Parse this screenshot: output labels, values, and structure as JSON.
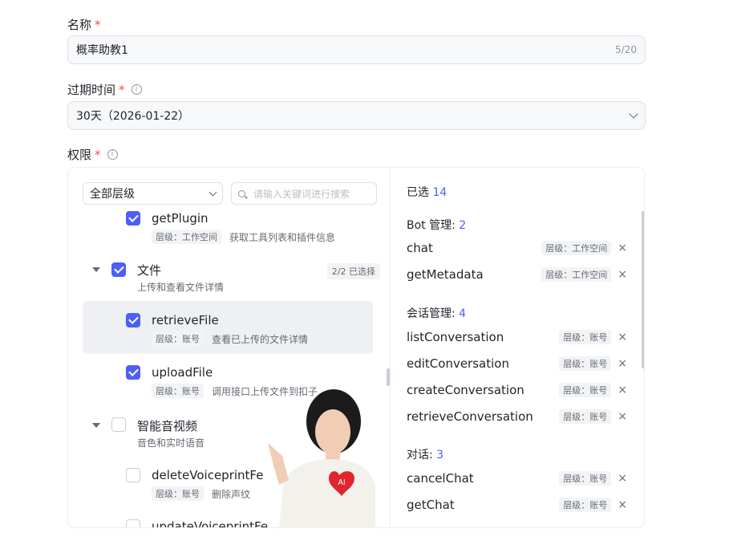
{
  "name_field": {
    "label": "名称",
    "required": "*",
    "value": "概率助教1",
    "counter": "5/20"
  },
  "expiry_field": {
    "label": "过期时间",
    "required": "*",
    "value": "30天（2026-01-22）"
  },
  "permission_field": {
    "label": "权限",
    "required": "*"
  },
  "left_panel": {
    "level_select": "全部层级",
    "search_placeholder": "请输入关键词进行搜索",
    "items": [
      {
        "name": "getPlugin",
        "level": "层级：工作空间",
        "desc": "获取工具列表和插件信息",
        "checked": true
      },
      {
        "group": "文件",
        "desc": "上传和查看文件详情",
        "badge": "2/2 已选择",
        "checked": true
      },
      {
        "name": "retrieveFile",
        "level": "层级：账号",
        "desc": "查看已上传的文件详情",
        "checked": true
      },
      {
        "name": "uploadFile",
        "level": "层级：账号",
        "desc": "调用接口上传文件到扣子",
        "checked": true
      },
      {
        "group": "智能音视频",
        "desc": "音色和实时语音",
        "checked": false
      },
      {
        "name": "deleteVoiceprintFe",
        "level": "层级：账号",
        "desc": "删除声纹",
        "checked": false
      },
      {
        "name": "updateVoiceprintFe",
        "checked": false
      }
    ]
  },
  "right_panel": {
    "selected_label": "已选",
    "selected_count": "14",
    "groups": [
      {
        "title": "Bot 管理:",
        "count": "2",
        "items": [
          {
            "name": "chat",
            "level": "层级：工作空间"
          },
          {
            "name": "getMetadata",
            "level": "层级：工作空间"
          }
        ]
      },
      {
        "title": "会话管理:",
        "count": "4",
        "items": [
          {
            "name": "listConversation",
            "level": "层级：账号"
          },
          {
            "name": "editConversation",
            "level": "层级：账号"
          },
          {
            "name": "createConversation",
            "level": "层级：账号"
          },
          {
            "name": "retrieveConversation",
            "level": "层级：账号"
          }
        ]
      },
      {
        "title": "对话:",
        "count": "3",
        "items": [
          {
            "name": "cancelChat",
            "level": "层级：账号"
          },
          {
            "name": "getChat",
            "level": "层级：账号"
          }
        ]
      }
    ],
    "remove_glyph": "×"
  },
  "overlay": {
    "badge_text": "AI"
  },
  "colors": {
    "accent": "#4e5ef7",
    "required": "#f54a45",
    "badge": "#e0252c"
  }
}
